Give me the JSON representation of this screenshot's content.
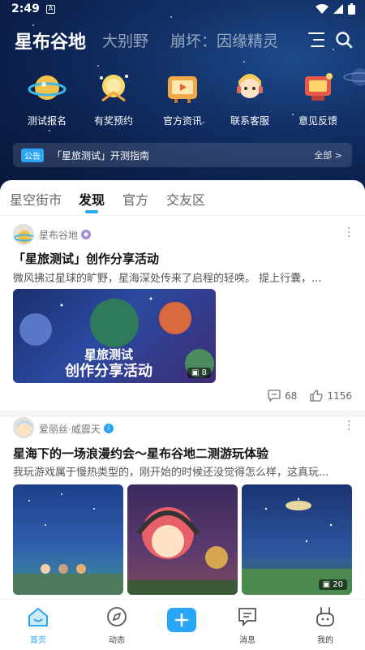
{
  "statusbar": {
    "time": "2:49",
    "notif_glyph": "A"
  },
  "top_tabs": [
    "星布谷地",
    "大别野",
    "崩坏：因缘精灵"
  ],
  "quick_links": [
    {
      "label": "测试报名",
      "icon": "planet-signup-icon"
    },
    {
      "label": "有奖预约",
      "icon": "gift-icon"
    },
    {
      "label": "官方资讯",
      "icon": "news-tv-icon"
    },
    {
      "label": "联系客服",
      "icon": "support-icon"
    },
    {
      "label": "意见反馈",
      "icon": "feedback-icon"
    }
  ],
  "notice": {
    "badge": "公告",
    "text": "「星旅测试」开测指南",
    "all": "全部 >"
  },
  "sub_tabs": [
    "星空街市",
    "发现",
    "官方",
    "交友区"
  ],
  "active_sub_tab": "发现",
  "posts": [
    {
      "author": "星布谷地",
      "title": "「星旅测试」创作分享活动",
      "excerpt": "微风拂过星球的旷野，星海深处传来了启程的轻唤。 提上行囊，...",
      "banner_line1": "星旅测试",
      "banner_line2": "创作分享活动",
      "image_count": "8",
      "comments": "68",
      "likes": "1156"
    },
    {
      "author": "爱丽丝·威震天",
      "title": "星海下的一场浪漫约会～星布谷地二测游玩体验",
      "excerpt": "我玩游戏属于慢热类型的，刚开始的时候还没觉得怎么样，这真玩...",
      "image_count": "20"
    }
  ],
  "bottom_nav": [
    "首页",
    "动态",
    "",
    "消息",
    "我的"
  ],
  "colors": {
    "accent": "#2ba5f5",
    "hero_bg": "#0d2350"
  }
}
